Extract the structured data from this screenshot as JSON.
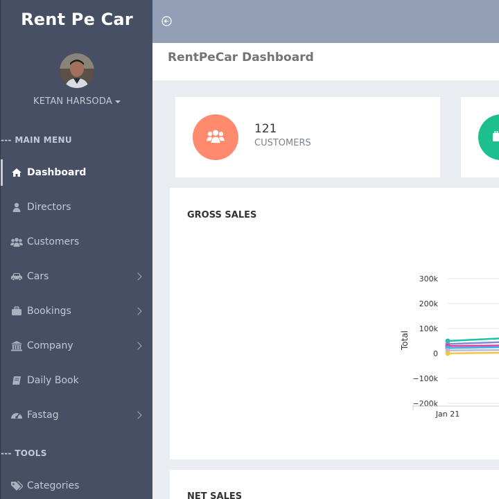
{
  "sidebar": {
    "brand": "Rent Pe Car",
    "user_name": "KETAN HARSODA",
    "main_menu_label": "--- MAIN MENU",
    "tools_label": "--- TOOLS",
    "items": [
      {
        "label": "Dashboard",
        "icon": "home-icon"
      },
      {
        "label": "Directors",
        "icon": "user-icon"
      },
      {
        "label": "Customers",
        "icon": "users-icon"
      },
      {
        "label": "Cars",
        "icon": "car-icon"
      },
      {
        "label": "Bookings",
        "icon": "briefcase-icon"
      },
      {
        "label": "Company",
        "icon": "bank-icon"
      },
      {
        "label": "Daily Book",
        "icon": "book-icon"
      },
      {
        "label": "Fastag",
        "icon": "dashboard-icon"
      },
      {
        "label": "Categories",
        "icon": "tags-icon"
      }
    ]
  },
  "header": {
    "page_title": "RentPeCar Dashboard"
  },
  "stats": [
    {
      "value": "121",
      "label": "CUSTOMERS",
      "color": "#ff8a6e"
    },
    {
      "value": "",
      "label": "",
      "color": "#1ebf8f"
    }
  ],
  "panels": {
    "gross_title": "GROSS SALES",
    "net_title": "NET SALES"
  },
  "chart_data": {
    "type": "line",
    "title": "GROSS SALES",
    "xlabel": "",
    "ylabel": "Total",
    "categories": [
      "Jan 21"
    ],
    "y_ticks": [
      "300k",
      "200k",
      "100k",
      "0",
      "−100k",
      "−200k"
    ],
    "ylim": [
      -200000,
      300000
    ],
    "series": [
      {
        "values": [
          50000,
          60000
        ],
        "color": "#1ec0a8"
      },
      {
        "values": [
          38000,
          45000
        ],
        "color": "#7f8ad8"
      },
      {
        "values": [
          30000,
          32000
        ],
        "color": "#e0409a"
      },
      {
        "values": [
          22000,
          25000
        ],
        "color": "#3ab0e8"
      },
      {
        "values": [
          12000,
          14000
        ],
        "color": "#b8b8d8"
      },
      {
        "values": [
          0,
          3000
        ],
        "color": "#f5c542"
      }
    ]
  },
  "colors": {
    "sidebar_bg": "#474f65",
    "topbar_bg": "#929fb6",
    "accent_orange": "#ff8a6e",
    "accent_green": "#1ebf8f"
  }
}
